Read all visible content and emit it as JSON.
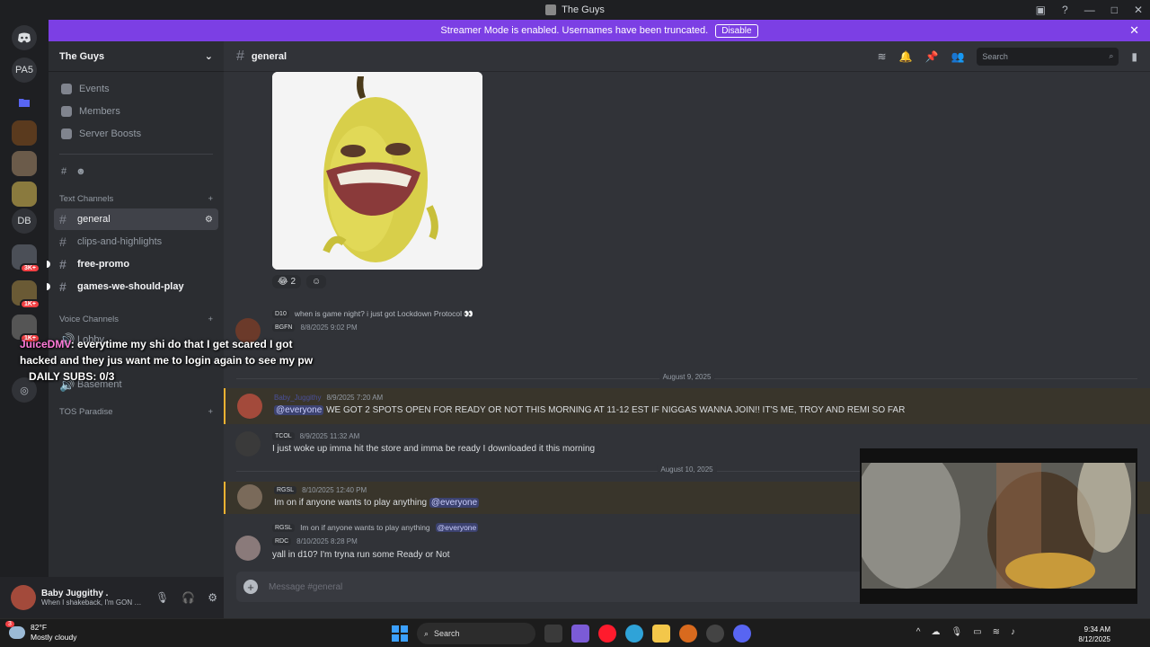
{
  "window": {
    "title": "The Guys"
  },
  "banner": {
    "text": "Streamer Mode is enabled. Usernames have been truncated.",
    "disable_label": "Disable"
  },
  "guilds": [
    {
      "label": "PA5"
    },
    {
      "label": "DB"
    },
    {
      "badge": "3K+"
    },
    {
      "badge": "1K+"
    },
    {
      "badge": "1K+"
    }
  ],
  "server": {
    "name": "The Guys",
    "nav": [
      "Events",
      "Members",
      "Server Boosts"
    ],
    "text_category": "Text Channels",
    "text_channels": [
      "general",
      "clips-and-highlights",
      "free-promo",
      "games-we-should-play"
    ],
    "voice_category": "Voice Channels",
    "voice_channels": [
      "Lobby",
      "Basement"
    ],
    "other_category": "TOS Paradise"
  },
  "user": {
    "name": "Baby Juggithy .",
    "status": "When I shakeback, I'm GON striv..."
  },
  "channel": {
    "name": "general",
    "search_placeholder": "Search",
    "composer_placeholder": "Message #general"
  },
  "reactions": [
    {
      "emoji": "😂",
      "count": "2"
    }
  ],
  "messages": [
    {
      "tag": "BGFN",
      "time": "8/8/2025 9:02 PM",
      "reply_tag": "D10",
      "reply_text": "when is game night? i just got Lockdown Protocol 👀"
    },
    {
      "divider": "August 9, 2025"
    },
    {
      "name": "Baby_Juggithy",
      "time": "8/9/2025 7:20 AM",
      "mention": "@everyone",
      "text": "WE GOT 2 SPOTS OPEN FOR READY OR NOT THIS MORNING AT 11-12 EST IF NIGGAS WANNA JOIN!! IT'S ME, TROY AND REMI SO FAR"
    },
    {
      "tag": "TCOL",
      "time": "8/9/2025 11:32 AM",
      "text": "I just woke up imma hit the store and imma be ready I downloaded it this morning"
    },
    {
      "divider": "August 10, 2025"
    },
    {
      "tag": "RGSL",
      "time": "8/10/2025 12:40 PM",
      "text": "Im on if anyone wants to play anything",
      "mention": "@everyone"
    },
    {
      "tag": "RDC",
      "time": "8/10/2025 8:28 PM",
      "reply_tag": "RGSL",
      "reply_text": "Im on if anyone wants to play anything",
      "reply_mention": "@everyone",
      "text": "yall in d10? I'm tryna run some Ready or Not"
    }
  ],
  "overlay": {
    "who": "JuiceDMV",
    "line1": ": everytime my shi do that I get scared I got",
    "line2": "hacked and they jus want me to login again to see my pw",
    "line3": "DAILY SUBS: 0/3"
  },
  "taskbar": {
    "weather_temp": "82°F",
    "weather_desc": "Mostly cloudy",
    "weather_badge": "3",
    "search_label": "Search",
    "time": "9:34 AM",
    "date": "8/12/2025"
  },
  "colors": {
    "blurple": "#5865f2",
    "banner": "#7c3fe4",
    "mention_bg": "#39352b",
    "mention_bar": "#f0b232"
  }
}
